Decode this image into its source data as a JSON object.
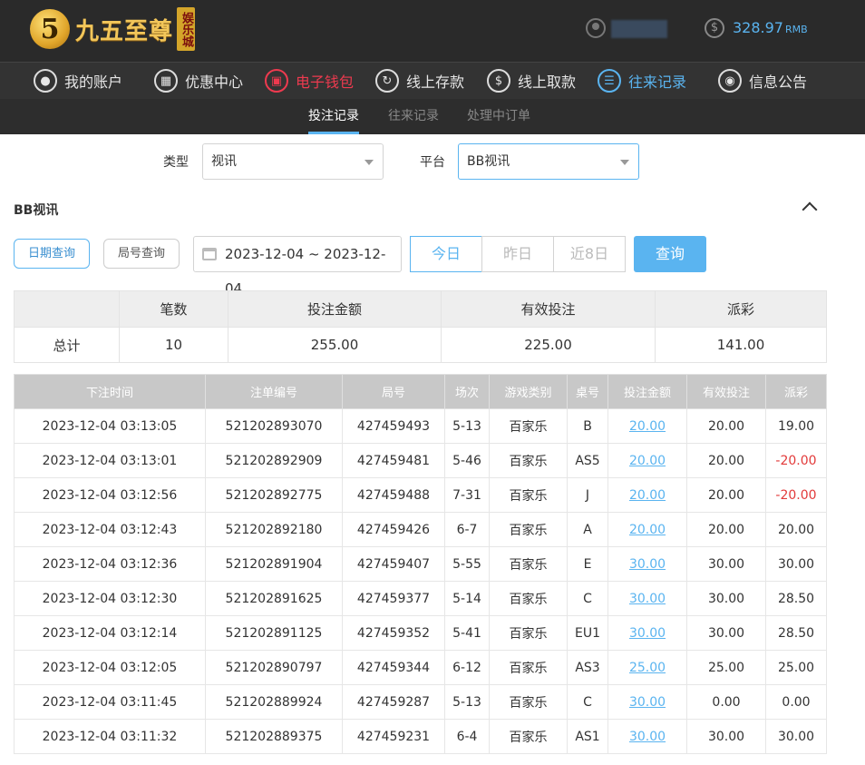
{
  "header": {
    "logo_digit": "5",
    "logo_text": "九五至尊",
    "logo_sub": "娱乐城",
    "balance_value": "328.97",
    "balance_unit": "RMB"
  },
  "nav": [
    {
      "label": "我的账户",
      "icon": "user-icon"
    },
    {
      "label": "优惠中心",
      "icon": "gift-icon"
    },
    {
      "label": "电子钱包",
      "icon": "wallet-icon"
    },
    {
      "label": "线上存款",
      "icon": "deposit-icon"
    },
    {
      "label": "线上取款",
      "icon": "withdraw-icon"
    },
    {
      "label": "往来记录",
      "icon": "records-icon"
    },
    {
      "label": "信息公告",
      "icon": "bell-icon"
    }
  ],
  "subnav": [
    "投注记录",
    "往来记录",
    "处理中订单"
  ],
  "filters": {
    "type_label": "类型",
    "type_value": "视讯",
    "platform_label": "平台",
    "platform_value": "BB视讯"
  },
  "section_title": "BB视讯",
  "query": {
    "date_query": "日期查询",
    "round_query": "局号查询",
    "date_range": "2023-12-04 ~ 2023-12-04",
    "today": "今日",
    "yesterday": "昨日",
    "last8": "近8日",
    "submit": "查询"
  },
  "summary": {
    "headers": [
      "",
      "笔数",
      "投注金额",
      "有效投注",
      "派彩"
    ],
    "row": [
      "总计",
      "10",
      "255.00",
      "225.00",
      "141.00"
    ]
  },
  "table": {
    "headers": [
      "下注时间",
      "注单编号",
      "局号",
      "场次",
      "游戏类别",
      "桌号",
      "投注金额",
      "有效投注",
      "派彩"
    ],
    "rows": [
      [
        "2023-12-04 03:13:05",
        "521202893070",
        "427459493",
        "5-13",
        "百家乐",
        "B",
        "20.00",
        "20.00",
        "19.00"
      ],
      [
        "2023-12-04 03:13:01",
        "521202892909",
        "427459481",
        "5-46",
        "百家乐",
        "AS5",
        "20.00",
        "20.00",
        "-20.00"
      ],
      [
        "2023-12-04 03:12:56",
        "521202892775",
        "427459488",
        "7-31",
        "百家乐",
        "J",
        "20.00",
        "20.00",
        "-20.00"
      ],
      [
        "2023-12-04 03:12:43",
        "521202892180",
        "427459426",
        "6-7",
        "百家乐",
        "A",
        "20.00",
        "20.00",
        "20.00"
      ],
      [
        "2023-12-04 03:12:36",
        "521202891904",
        "427459407",
        "5-55",
        "百家乐",
        "E",
        "30.00",
        "30.00",
        "30.00"
      ],
      [
        "2023-12-04 03:12:30",
        "521202891625",
        "427459377",
        "5-14",
        "百家乐",
        "C",
        "30.00",
        "30.00",
        "28.50"
      ],
      [
        "2023-12-04 03:12:14",
        "521202891125",
        "427459352",
        "5-41",
        "百家乐",
        "EU1",
        "30.00",
        "30.00",
        "28.50"
      ],
      [
        "2023-12-04 03:12:05",
        "521202890797",
        "427459344",
        "6-12",
        "百家乐",
        "AS3",
        "25.00",
        "25.00",
        "25.00"
      ],
      [
        "2023-12-04 03:11:45",
        "521202889924",
        "427459287",
        "5-13",
        "百家乐",
        "C",
        "30.00",
        "0.00",
        "0.00"
      ],
      [
        "2023-12-04 03:11:32",
        "521202889375",
        "427459231",
        "6-4",
        "百家乐",
        "AS1",
        "30.00",
        "30.00",
        "30.00"
      ]
    ]
  },
  "colors": {
    "accent": "#5ab4f0",
    "negative": "#e23a3a",
    "active_red": "#ee3a4f"
  }
}
